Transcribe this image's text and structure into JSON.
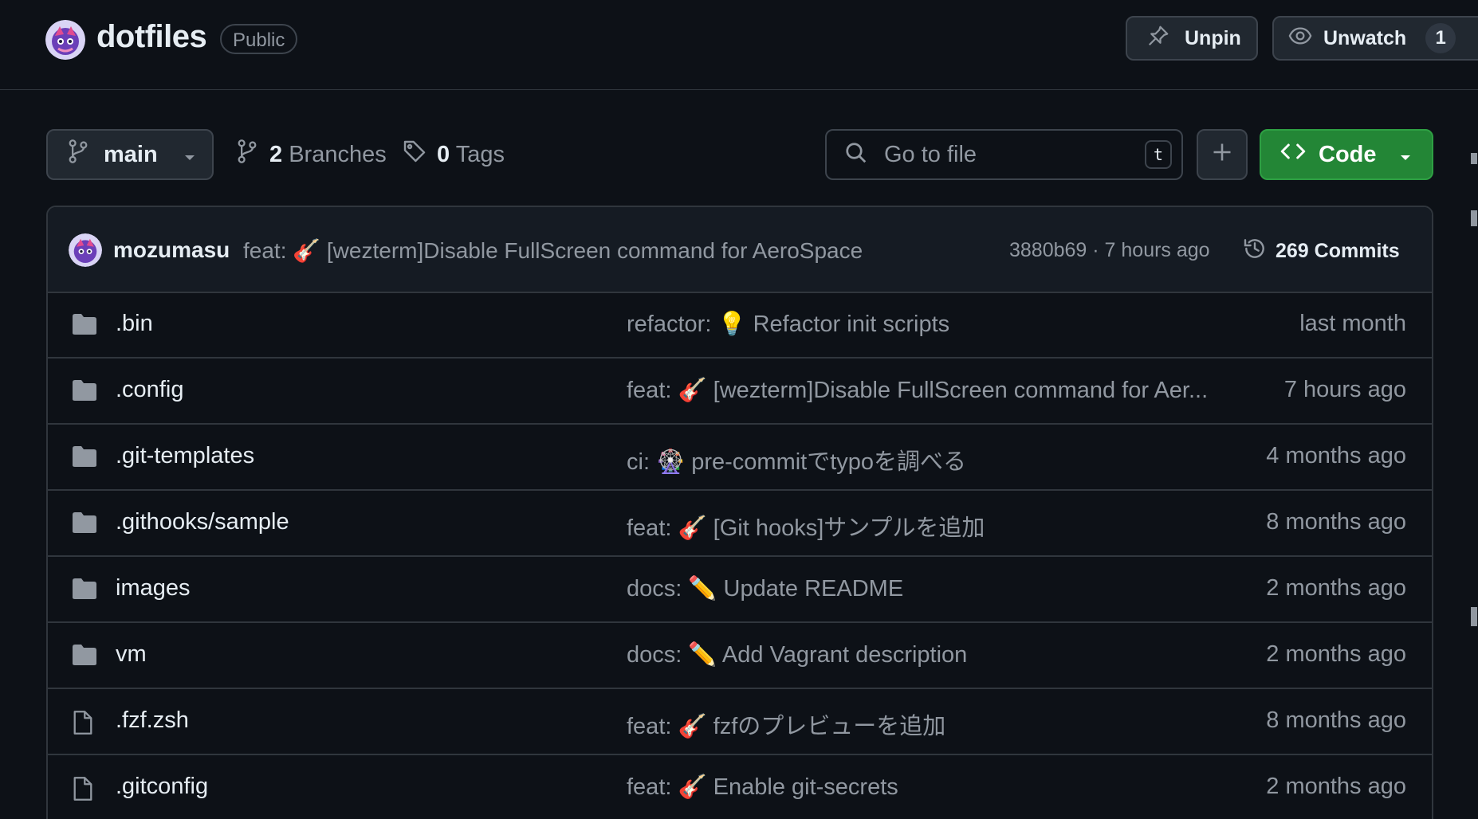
{
  "repo": {
    "name": "dotfiles",
    "visibility": "Public",
    "unpin_label": "Unpin",
    "unwatch_label": "Unwatch",
    "watch_count": "1"
  },
  "toolbar": {
    "branch": "main",
    "branches_count": "2",
    "branches_label": "Branches",
    "tags_count": "0",
    "tags_label": "Tags",
    "search_placeholder": "Go to file",
    "search_shortcut": "t",
    "code_label": "Code"
  },
  "latest_commit": {
    "author": "mozumasu",
    "message": "feat: 🎸 [wezterm]Disable FullScreen command for AeroSpace",
    "meta": "3880b69 · 7 hours ago",
    "commits_label": "269 Commits"
  },
  "files": [
    {
      "name": ".bin",
      "type": "dir",
      "message": "refactor: 💡 Refactor init scripts",
      "time": "last month"
    },
    {
      "name": ".config",
      "type": "dir",
      "message": "feat: 🎸 [wezterm]Disable FullScreen command for Aer...",
      "time": "7 hours ago"
    },
    {
      "name": ".git-templates",
      "type": "dir",
      "message": "ci: 🎡 pre-commitでtypoを調べる",
      "time": "4 months ago"
    },
    {
      "name": ".githooks/sample",
      "type": "dir",
      "message": "feat: 🎸 [Git hooks]サンプルを追加",
      "time": "8 months ago"
    },
    {
      "name": "images",
      "type": "dir",
      "message": "docs: ✏️ Update README",
      "time": "2 months ago"
    },
    {
      "name": "vm",
      "type": "dir",
      "message": "docs: ✏️ Add Vagrant description",
      "time": "2 months ago"
    },
    {
      "name": ".fzf.zsh",
      "type": "file",
      "message": "feat: 🎸 fzfのプレビューを追加",
      "time": "8 months ago"
    },
    {
      "name": ".gitconfig",
      "type": "file",
      "message": "feat: 🎸 Enable git-secrets",
      "time": "2 months ago"
    }
  ],
  "colors": {
    "background": "#0d1117",
    "border": "#30363d",
    "code_button": "#238636",
    "muted_text": "#9198a1"
  }
}
